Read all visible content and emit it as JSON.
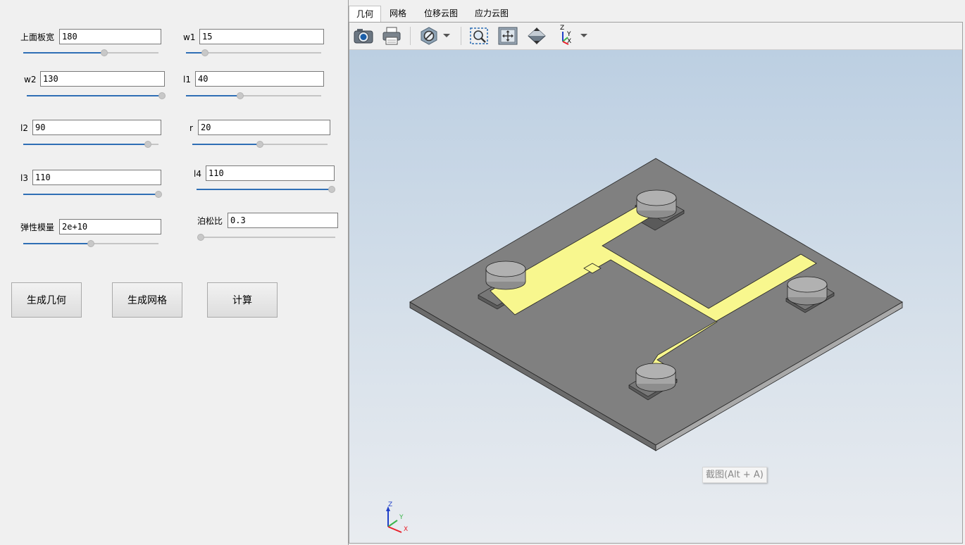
{
  "params": {
    "top_width": {
      "label": "上面板宽",
      "value": "180",
      "level": 0.6
    },
    "w1": {
      "label": "w1",
      "value": "15",
      "level": 0.14
    },
    "w2": {
      "label": "w2",
      "value": "130",
      "level": 1.0
    },
    "l1": {
      "label": "l1",
      "value": "40",
      "level": 0.4
    },
    "l2": {
      "label": "l2",
      "value": "90",
      "level": 0.92
    },
    "r": {
      "label": "r",
      "value": "20",
      "level": 0.5
    },
    "l3": {
      "label": "l3",
      "value": "110",
      "level": 1.0
    },
    "l4": {
      "label": "l4",
      "value": "110",
      "level": 1.0
    },
    "youngs_modulus": {
      "label": "弹性模量",
      "value": "2e+10",
      "level": 0.5
    },
    "poisson_ratio": {
      "label": "泊松比",
      "value": "0.3",
      "level": 0.0
    }
  },
  "buttons": {
    "generate_geometry": "生成几何",
    "generate_mesh": "生成网格",
    "compute": "计算"
  },
  "tabs": [
    "几何",
    "网格",
    "位移云图",
    "应力云图"
  ],
  "active_tab": "几何",
  "toolbar": {
    "tools": [
      "camera-icon",
      "print-icon",
      "visibility-icon",
      "fit-selection-icon",
      "fit-all-icon",
      "view-iso-icon",
      "axes-orientation-icon"
    ],
    "axis_letters": [
      "Z",
      "Y",
      "X"
    ]
  },
  "viewport": {
    "tooltip": "截图(Alt + A)",
    "triad_letters": [
      "Z",
      "Y",
      "X"
    ]
  },
  "colors": {
    "plate": "#808080",
    "trace": "#f8f78e",
    "slider_fill": "#2f6fb5",
    "axis_x": "#e8202a",
    "axis_y": "#3bb54a",
    "axis_z": "#1f3fc8"
  }
}
